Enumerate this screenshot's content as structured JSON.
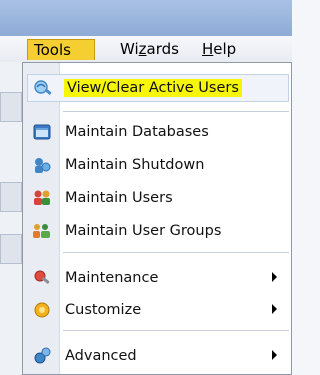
{
  "menubar": {
    "tools": "Tools",
    "wizards_prefix": "Wi",
    "wizards_accel": "z",
    "wizards_suffix": "ards",
    "help_accel": "H",
    "help_suffix": "elp"
  },
  "menu_items": [
    {
      "label": "View/Clear Active Users",
      "icon": "users-view-icon"
    },
    {
      "label": "Maintain Databases",
      "icon": "database-icon"
    },
    {
      "label": "Maintain Shutdown",
      "icon": "shutdown-icon"
    },
    {
      "label": "Maintain Users",
      "icon": "users-icon"
    },
    {
      "label": "Maintain User Groups",
      "icon": "user-groups-icon"
    },
    {
      "label": "Maintenance",
      "icon": "maintenance-icon",
      "submenu": true
    },
    {
      "label": "Customize",
      "icon": "customize-icon",
      "submenu": true
    },
    {
      "label": "Advanced",
      "icon": "advanced-icon",
      "submenu": true
    }
  ],
  "colors": {
    "highlight": "#f6f60a",
    "active_menu": "#f5cf32"
  }
}
